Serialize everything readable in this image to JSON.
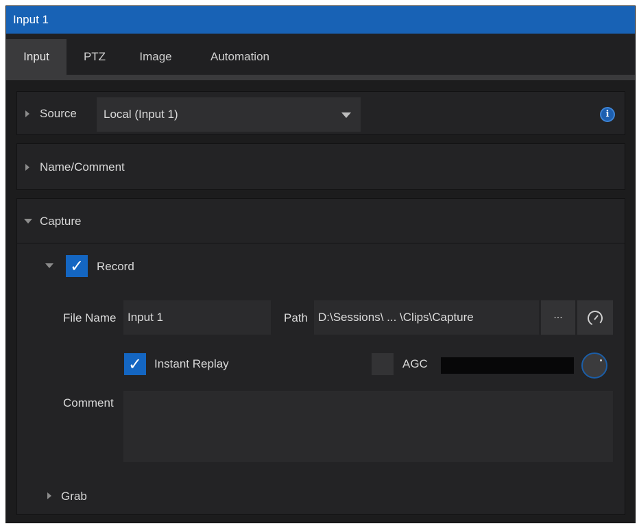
{
  "window": {
    "title": "Input 1"
  },
  "tabs": [
    {
      "label": "Input",
      "active": true
    },
    {
      "label": "PTZ",
      "active": false
    },
    {
      "label": "Image",
      "active": false
    },
    {
      "label": "Automation",
      "active": false
    }
  ],
  "source": {
    "label": "Source",
    "value": "Local (Input 1)",
    "info_icon": "i"
  },
  "name_comment": {
    "label": "Name/Comment"
  },
  "capture": {
    "label": "Capture",
    "record": {
      "label": "Record",
      "checked": true,
      "check_glyph": "✓"
    },
    "file_name": {
      "label": "File Name",
      "value": "Input 1"
    },
    "path": {
      "label": "Path",
      "value": "D:\\Sessions\\ ... \\Clips\\Capture",
      "browse_label": "..."
    },
    "instant_replay": {
      "label": "Instant Replay",
      "checked": true,
      "check_glyph": "✓"
    },
    "agc": {
      "label": "AGC",
      "checked": false
    },
    "comment": {
      "label": "Comment",
      "value": ""
    }
  },
  "grab": {
    "label": "Grab"
  },
  "colors": {
    "titlebar": "#1862b5",
    "checkbox_on": "#1466c2",
    "panel": "#232325",
    "background": "#1c1c1d"
  },
  "icons": [
    "expand-arrow-icon",
    "collapse-arrow-icon",
    "info-icon",
    "checkmark-icon",
    "gauge-icon",
    "knob-icon",
    "dropdown-caret-icon"
  ]
}
